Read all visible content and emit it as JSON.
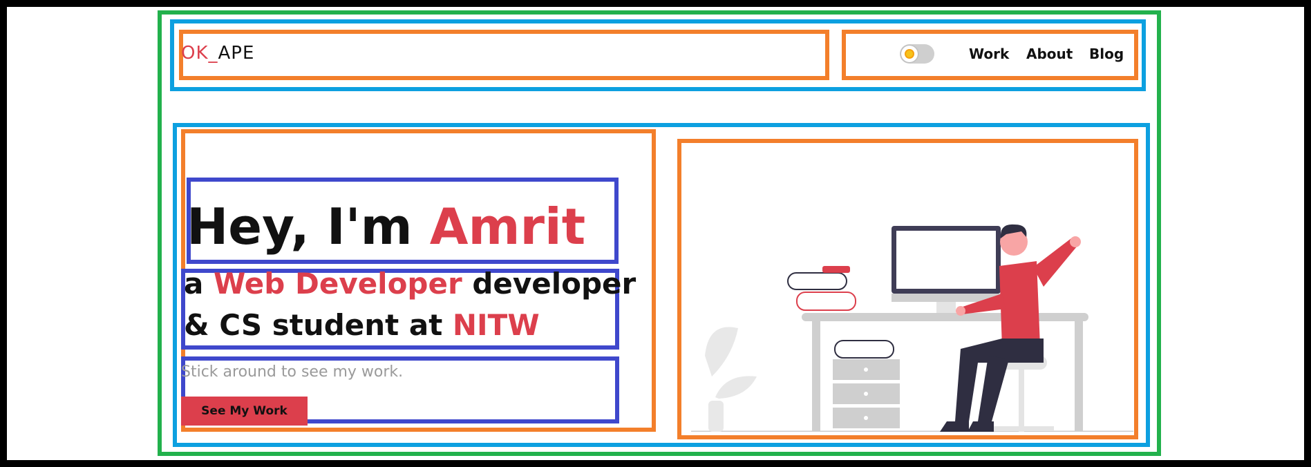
{
  "navbar": {
    "logo_accent": "OK_",
    "logo_text": "APE",
    "links": [
      "Work",
      "About",
      "Blog"
    ]
  },
  "hero": {
    "greeting": "Hey, I'm ",
    "name": "Amrit",
    "line1_prefix": "a ",
    "role": "Web Developer",
    "line1_suffix": " developer",
    "line2_prefix": "& CS student at ",
    "school": "NITW",
    "subtitle": "Stick around to see my work.",
    "cta_label": "See My Work"
  },
  "colors": {
    "accent": "#dc3f4c",
    "frame": "#000000",
    "green_box": "#22b14c",
    "blue_box": "#0da0e0",
    "orange_box": "#f37f2b",
    "indigo_box": "#3f48cc"
  },
  "icons": [
    "sun-icon",
    "theme-toggle"
  ]
}
